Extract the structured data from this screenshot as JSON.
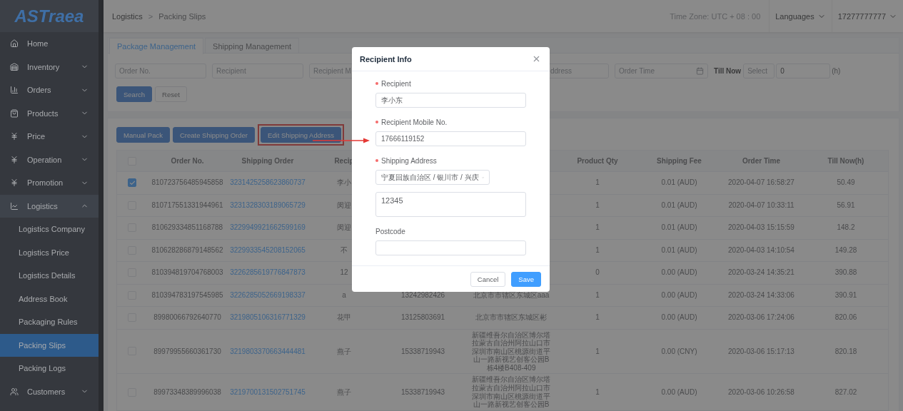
{
  "sidebar": {
    "logo": "ASTraea",
    "items": [
      {
        "label": "Home",
        "kind": "link",
        "selected": false
      },
      {
        "label": "Inventory",
        "kind": "group",
        "expanded": false,
        "selected": false
      },
      {
        "label": "Orders",
        "kind": "group",
        "expanded": false,
        "selected": false
      },
      {
        "label": "Products",
        "kind": "group",
        "expanded": false,
        "selected": false
      },
      {
        "label": "Price",
        "kind": "group",
        "expanded": false,
        "selected": false
      },
      {
        "label": "Operation",
        "kind": "group",
        "expanded": false,
        "selected": false
      },
      {
        "label": "Promotion",
        "kind": "group",
        "expanded": false,
        "selected": false
      },
      {
        "label": "Logistics",
        "kind": "group",
        "expanded": true,
        "selected": false,
        "children": [
          {
            "label": "Logistics Company",
            "selected": false
          },
          {
            "label": "Logistics Price",
            "selected": false
          },
          {
            "label": "Logistics Details",
            "selected": false
          },
          {
            "label": "Address Book",
            "selected": false
          },
          {
            "label": "Packaging Rules",
            "selected": false
          },
          {
            "label": "Packing Slips",
            "selected": true
          },
          {
            "label": "Packing Logs",
            "selected": false
          }
        ]
      },
      {
        "label": "Customers",
        "kind": "group",
        "expanded": false,
        "selected": false
      }
    ]
  },
  "header": {
    "breadcrumb": [
      "Logistics",
      "Packing Slips"
    ],
    "separator": ">",
    "time_zone": "Time Zone: UTC + 08 : 00",
    "language": "Languages",
    "account": "17277777777"
  },
  "tabs": [
    {
      "label": "Package Management",
      "selected": true
    },
    {
      "label": "Shipping Management",
      "selected": false
    }
  ],
  "filters": {
    "fields": [
      {
        "kind": "text",
        "placeholder": "Order No."
      },
      {
        "kind": "text",
        "placeholder": "Recipient"
      },
      {
        "kind": "text",
        "placeholder": "Recipient M"
      },
      {
        "kind": "text",
        "placeholder": "ddress"
      },
      {
        "kind": "date",
        "placeholder": "Order Time"
      }
    ],
    "till_now": {
      "label": "Till Now",
      "select_placeholder": "Select",
      "value": "0",
      "unit": "(h)"
    },
    "buttons": [
      "Search",
      "Reset"
    ]
  },
  "actions": [
    {
      "label": "Manual Pack",
      "highlighted": false
    },
    {
      "label": "Create Shipping Order",
      "highlighted": false
    },
    {
      "label": "Edit Shipping Address",
      "highlighted": true
    }
  ],
  "table": {
    "all_selected": false,
    "columns": [
      {
        "label": "Order No."
      },
      {
        "label": "Shipping Order"
      },
      {
        "label": "Recip"
      },
      {},
      {},
      {
        "label": "Product Qty"
      },
      {
        "label": "Shipping Fee"
      },
      {
        "label": "Order Time"
      },
      {
        "label": "Till Now(h)"
      }
    ],
    "rows": [
      {
        "selected": true,
        "order_no": "810723756485945858",
        "shipping_order": "3231425258623860737",
        "recipient": "李小",
        "product_qty": "1",
        "shipping_fee": "0.01 (AUD)",
        "order_time": "2020-04-07 16:58:27",
        "till_now": "50.49"
      },
      {
        "selected": false,
        "order_no": "810717551331944961",
        "shipping_order": "3231328303189065729",
        "recipient": "闵迎",
        "product_qty": "1",
        "shipping_fee": "0.01 (AUD)",
        "order_time": "2020-04-07 10:33:11",
        "till_now": "56.91"
      },
      {
        "selected": false,
        "order_no": "810629334851168788",
        "shipping_order": "3229949921662599169",
        "recipient": "闵迎",
        "product_qty": "1",
        "shipping_fee": "0.01 (AUD)",
        "order_time": "2020-04-03 15:15:59",
        "till_now": "148.2"
      },
      {
        "selected": false,
        "order_no": "810628286879148562",
        "shipping_order": "3229933545208152065",
        "recipient": "不",
        "product_qty": "1",
        "shipping_fee": "0.01 (AUD)",
        "order_time": "2020-04-03 14:10:54",
        "till_now": "149.28"
      },
      {
        "selected": false,
        "order_no": "810394819704768003",
        "shipping_order": "3226285619776847873",
        "recipient": "12",
        "product_qty": "0",
        "shipping_fee": "0.00 (AUD)",
        "order_time": "2020-03-24 14:35:21",
        "till_now": "390.88"
      },
      {
        "selected": false,
        "order_no": "810394783197545985",
        "shipping_order": "3226285052669198337",
        "recipient": "a",
        "column_5": "13242982426",
        "column_6": "北京市市辖区东城区aaa",
        "product_qty": "1",
        "shipping_fee": "0.00 (AUD)",
        "order_time": "2020-03-24 14:33:06",
        "till_now": "390.91"
      },
      {
        "selected": false,
        "order_no": "89980066792640770",
        "shipping_order": "3219805106316771329",
        "recipient": "花甲",
        "column_5": "13125803691",
        "column_6": "北京市市辖区东城区彬",
        "product_qty": "1",
        "shipping_fee": "0.00 (AUD)",
        "order_time": "2020-03-06 17:24:06",
        "till_now": "820.06"
      },
      {
        "selected": false,
        "order_no": "89979955660361730",
        "shipping_order": "3219803370663444481",
        "recipient": "燕子",
        "column_5": "15338719943",
        "column_6": "新疆维吾尔自治区博尔塔拉蒙古自治州阿拉山口市深圳市南山区桃源街道平山一路新视艺创客公园B栋4楼B408-409",
        "product_qty": "1",
        "shipping_fee": "0.00 (CNY)",
        "order_time": "2020-03-06 15:17:13",
        "till_now": "820.18"
      },
      {
        "selected": false,
        "order_no": "89973348389996038",
        "shipping_order": "3219700131502751745",
        "recipient": "燕子",
        "column_5": "15338719943",
        "column_6": "新疆维吾尔自治区博尔塔拉蒙古自治州阿拉山口市深圳市南山区桃源街道平山一路新视艺创客公园B",
        "product_qty": "1",
        "shipping_fee": "0.00 (AUD)",
        "order_time": "2020-03-06 10:26:58",
        "till_now": "827.02"
      }
    ]
  },
  "dialog": {
    "title": "Recipient Info",
    "fields": [
      {
        "kind": "input",
        "label": "Recipient",
        "required": true,
        "value": "李小东"
      },
      {
        "kind": "input",
        "label": "Recipient Mobile No.",
        "required": true,
        "value": "17666119152"
      },
      {
        "kind": "address",
        "label": "Shipping Address",
        "required": true,
        "region": "宁夏回族自治区 / 银川市 / 兴庆",
        "detail": "12345"
      },
      {
        "kind": "input",
        "label": "Postcode",
        "required": false
      }
    ],
    "buttons": [
      {
        "label": "Cancel",
        "primary": false
      },
      {
        "label": "Save",
        "primary": true
      }
    ]
  }
}
